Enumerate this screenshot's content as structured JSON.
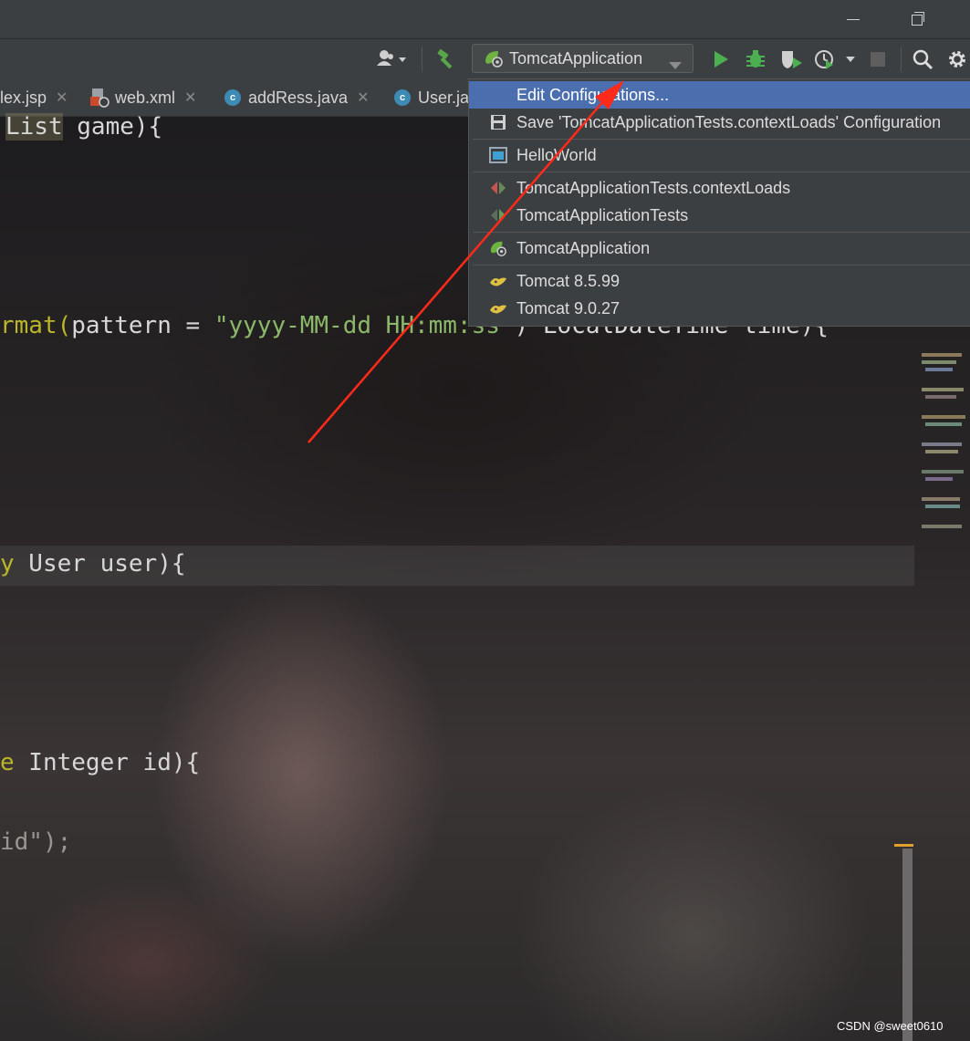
{
  "toolbar": {
    "run_config_label": "TomcatApplication"
  },
  "tabs": [
    {
      "label": "lex.jsp"
    },
    {
      "label": "web.xml"
    },
    {
      "label": "addRess.java"
    },
    {
      "label": "User.ja"
    }
  ],
  "code_lines": {
    "line1_type": "List",
    "line1_rest": " game){",
    "line2_prefix": "rmat(",
    "line2_mid": "pattern = ",
    "line2_str": "\"yyyy-MM-dd HH:mm:ss\"",
    "line2_rest": ") LocalDateTime time){",
    "line3_prefix": "y",
    "line3_rest": " User user){",
    "line4_prefix": "e",
    "line4_rest": " Integer id){",
    "line5": "id\");"
  },
  "run_menu": {
    "items": [
      {
        "label": "Edit Configurations...",
        "icon": "none",
        "selected": true
      },
      {
        "label": "Save 'TomcatApplicationTests.contextLoads' Configuration",
        "icon": "save-icon"
      },
      {
        "label": "HelloWorld",
        "icon": "application-icon"
      },
      {
        "label": "TomcatApplicationTests.contextLoads",
        "icon": "junit-method-icon"
      },
      {
        "label": "TomcatApplicationTests",
        "icon": "junit-class-icon"
      },
      {
        "label": "TomcatApplication",
        "icon": "spring-boot-icon"
      },
      {
        "label": "Tomcat 8.5.99",
        "icon": "tomcat-icon"
      },
      {
        "label": "Tomcat 9.0.27",
        "icon": "tomcat-icon"
      }
    ]
  },
  "colors": {
    "selected_bg": "#4b6eaf",
    "arrow": "#ff2a1a",
    "run_green": "#4caf50"
  },
  "watermark": "CSDN @sweet0610"
}
